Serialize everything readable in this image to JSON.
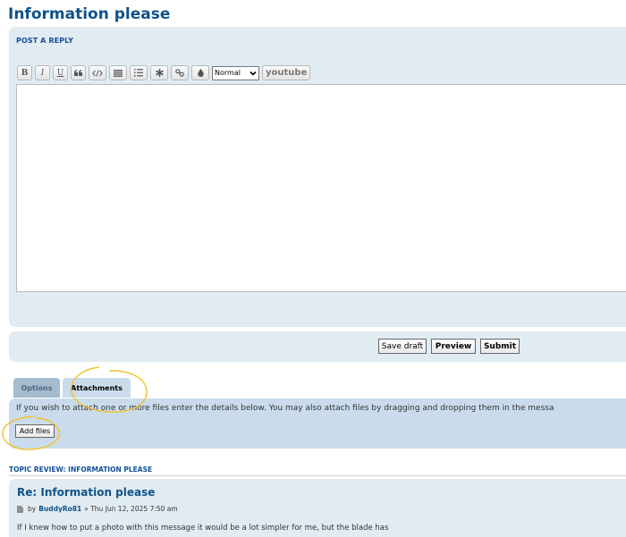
{
  "page": {
    "title": "Information please"
  },
  "reply": {
    "heading": "POST A REPLY",
    "toolbar": {
      "bold": "B",
      "italic": "I",
      "underline": "U",
      "font_size_selected": "Normal",
      "youtube": "youtube"
    }
  },
  "actions": {
    "save_draft": "Save draft",
    "preview": "Preview",
    "submit": "Submit"
  },
  "tabs": {
    "options": "Options",
    "attachments": "Attachments"
  },
  "attachments": {
    "instructions": "If you wish to attach one or more files enter the details below. You may also attach files by dragging and dropping them in the messa",
    "add_files": "Add files"
  },
  "review": {
    "heading": "TOPIC REVIEW: INFORMATION PLEASE",
    "post": {
      "title": "Re: Information please",
      "by": "by",
      "author": "BuddyRo81",
      "date": "» Thu Jun 12, 2025 7:50 am",
      "body": "If I knew how to put a photo with this message it would be a lot simpler for me, but the blade has"
    }
  },
  "colors": {
    "link_blue": "#105289",
    "panel_bg": "#e1ebf2",
    "attach_bg": "#cadceb",
    "annotation_yellow": "#f2c12e"
  }
}
